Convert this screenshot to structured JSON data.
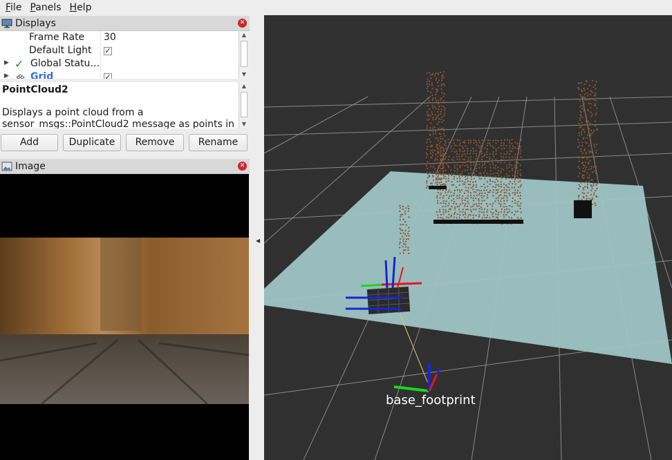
{
  "menu": {
    "items": [
      {
        "mnemonic": "F",
        "rest": "ile"
      },
      {
        "mnemonic": "P",
        "rest": "anels"
      },
      {
        "mnemonic": "H",
        "rest": "elp"
      }
    ]
  },
  "displays_panel": {
    "title": "Displays",
    "close_glyph": "✕",
    "rows": [
      {
        "key": "Frame Rate",
        "value": "30"
      },
      {
        "key": "Default Light",
        "checked": true
      },
      {
        "key": "Global Statu…",
        "status_mark": "✓"
      },
      {
        "key": "Grid",
        "checked": true
      }
    ]
  },
  "description": {
    "title": "PointCloud2",
    "text": "Displays a point cloud from a sensor_msgs::PointCloud2 message as points in"
  },
  "buttons": {
    "add": "Add",
    "duplicate": "Duplicate",
    "remove": "Remove",
    "rename": "Rename"
  },
  "image_panel": {
    "title": "Image",
    "close_glyph": "✕"
  },
  "viewport": {
    "frame_label": "base_footprint",
    "colors": {
      "background": "#303030",
      "grid": "#a0a0a0",
      "ground": "#9ec4c4",
      "points": "#8a5530",
      "axis_x": "#e8141e",
      "axis_y": "#19d819",
      "axis_z": "#1525d8"
    }
  },
  "icons": {
    "monitor": "monitor-icon",
    "image": "image-icon",
    "collapse": "collapse-left-arrow-icon"
  }
}
